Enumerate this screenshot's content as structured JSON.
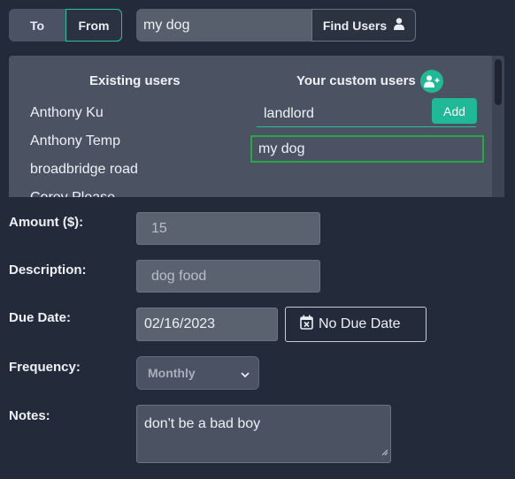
{
  "direction_toggle": {
    "to_label": "To",
    "from_label": "From",
    "selected": "From"
  },
  "search": {
    "value": "my dog",
    "button_label": "Find Users"
  },
  "users_panel": {
    "existing_header": "Existing users",
    "custom_header": "Your custom users",
    "existing_users": [
      "Anthony Ku",
      "Anthony Temp",
      "broadbridge road",
      "Corey Please"
    ],
    "custom_input_value": "landlord",
    "add_label": "Add",
    "custom_users": [
      "my dog"
    ]
  },
  "form": {
    "amount": {
      "label": "Amount ($):",
      "value": "15"
    },
    "description": {
      "label": "Description:",
      "value": "dog food"
    },
    "due_date": {
      "label": "Due Date:",
      "value": "02/16/2023",
      "no_due_label": "No Due Date"
    },
    "frequency": {
      "label": "Frequency:",
      "value": "Monthly"
    },
    "notes": {
      "label": "Notes:",
      "value": "don't be a bad boy"
    }
  },
  "colors": {
    "background": "#232a39",
    "accent": "#20b998",
    "selected_border": "#28a745"
  }
}
